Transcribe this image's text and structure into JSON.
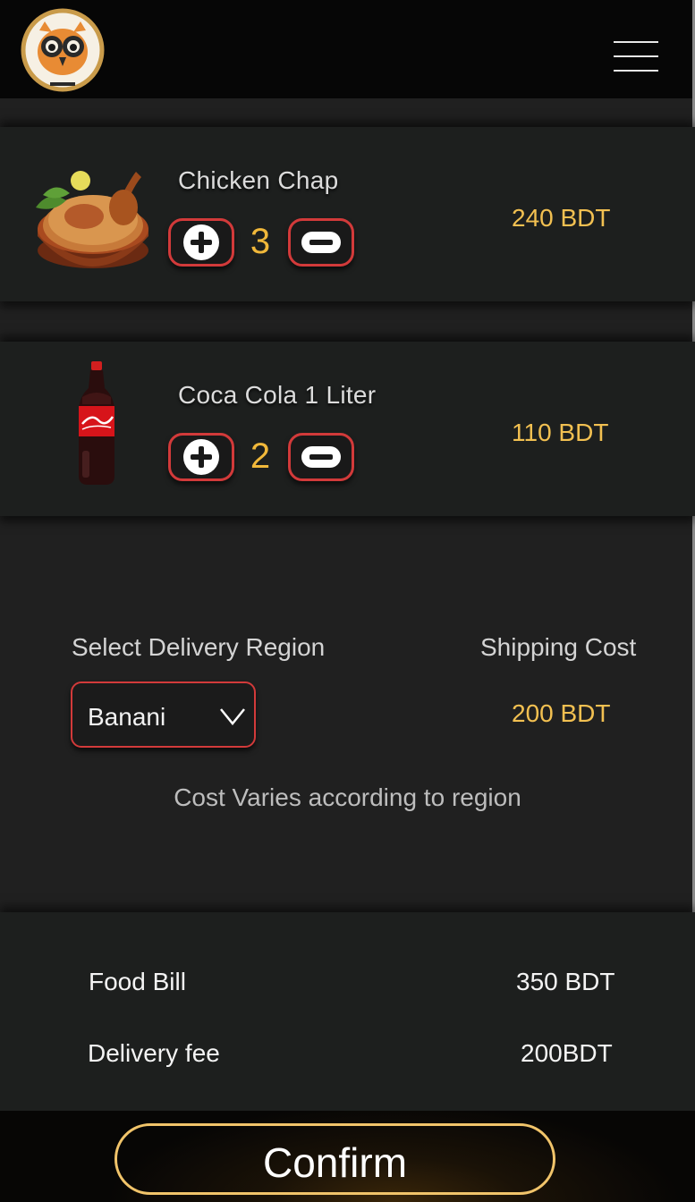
{
  "header": {
    "logo_icon": "owl-logo-icon",
    "menu_icon": "hamburger-menu-icon"
  },
  "cart": {
    "items": [
      {
        "name": "Chicken Chap",
        "quantity": "3",
        "price": "240 BDT",
        "image": "chicken-biryani-bowl-icon"
      },
      {
        "name": "Coca Cola 1  Liter",
        "quantity": "2",
        "price": "110 BDT",
        "image": "coca-cola-bottle-icon"
      }
    ],
    "plus_icon": "plus-icon",
    "minus_icon": "minus-icon"
  },
  "delivery": {
    "region_label": "Select Delivery Region",
    "shipping_label": "Shipping Cost",
    "selected_region": "Banani",
    "shipping_value": "200 BDT",
    "note": "Cost Varies according to region"
  },
  "totals": {
    "food_bill_label": "Food Bill",
    "food_bill_value": "350 BDT",
    "delivery_fee_label": "Delivery fee",
    "delivery_fee_value": "200BDT"
  },
  "footer": {
    "confirm_label": "Confirm"
  },
  "colors": {
    "accent_red": "#d23a3a",
    "price_gold": "#f2c051",
    "confirm_border": "#f1c46a",
    "background": "#202020",
    "panel": "#1d1f1e"
  }
}
